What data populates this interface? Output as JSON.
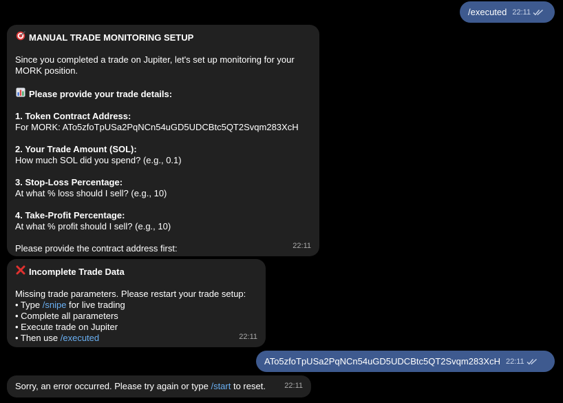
{
  "messages": {
    "m1": {
      "text": "/executed",
      "time": "22:11"
    },
    "m2": {
      "title": "MANUAL TRADE MONITORING SETUP",
      "title_icon": "direct-hit-icon",
      "intro1": "Since you completed a trade on Jupiter, let's set up monitoring for your",
      "intro2": "MORK position.",
      "details_heading": "Please provide your trade details:",
      "details_icon": "bar-chart-icon",
      "s1_title": "1. Token Contract Address:",
      "s1_body": "For MORK: ATo5zfoTpUSa2PqNCn54uGD5UDCBtc5QT2Svqm283XcH",
      "s2_title": "2. Your Trade Amount (SOL):",
      "s2_body": "How much SOL did you spend? (e.g., 0.1)",
      "s3_title": "3. Stop-Loss Percentage:",
      "s3_body": "At what % loss should I sell? (e.g., 10)",
      "s4_title": "4. Take-Profit Percentage:",
      "s4_body": "At what % profit should I sell? (e.g., 10)",
      "footer": "Please provide the contract address first:",
      "time": "22:11"
    },
    "m3": {
      "title": "Incomplete Trade Data",
      "title_icon": "cross-mark-icon",
      "body1": "Missing trade parameters. Please restart your trade setup:",
      "b1_pre": "• Type ",
      "b1_link": "/snipe",
      "b1_post": " for live trading",
      "b2": "• Complete all parameters",
      "b3": "• Execute trade on Jupiter",
      "b4_pre": "• Then use ",
      "b4_link": "/executed",
      "time": "22:11"
    },
    "m4": {
      "text": "ATo5zfoTpUSa2PqNCn54uGD5UDCBtc5QT2Svqm283XcH",
      "time": "22:11"
    },
    "m5": {
      "pre": "Sorry, an error occurred. Please try again or type ",
      "link": "/start",
      "post": " to reset.",
      "time": "22:11"
    }
  },
  "colors": {
    "background": "#000000",
    "incoming_bubble": "#212121",
    "outgoing_bubble": "#3e5a8f",
    "link": "#6ab0f3"
  }
}
